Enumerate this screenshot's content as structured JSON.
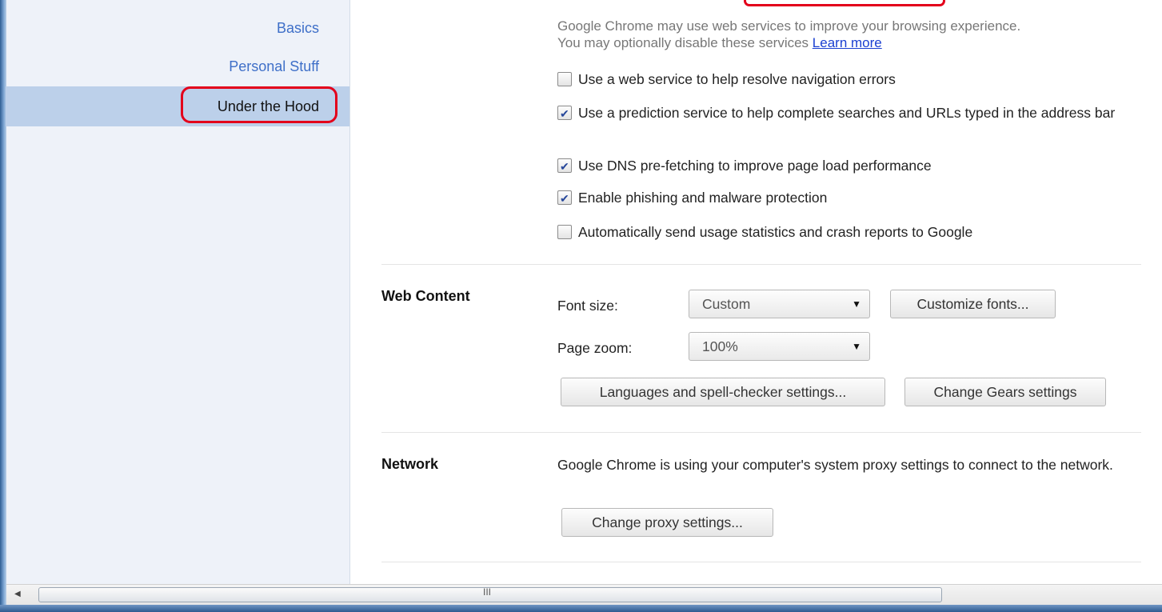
{
  "sidebar": {
    "items": [
      {
        "label": "Basics"
      },
      {
        "label": "Personal Stuff"
      },
      {
        "label": "Under the Hood"
      }
    ]
  },
  "privacy": {
    "description_line1": "Google Chrome may use web services to improve your browsing experience.",
    "description_line2": "You may optionally disable these services",
    "learn_more": "Learn more",
    "options": [
      {
        "label": "Use a web service to help resolve navigation errors",
        "checked": false
      },
      {
        "label": "Use a prediction service to help complete searches and URLs typed in the address bar",
        "checked": true
      },
      {
        "label": "Use DNS pre-fetching to improve page load performance",
        "checked": true
      },
      {
        "label": "Enable phishing and malware protection",
        "checked": true
      },
      {
        "label": "Automatically send usage statistics and crash reports to Google",
        "checked": false
      }
    ]
  },
  "web_content": {
    "title": "Web Content",
    "font_size_label": "Font size:",
    "font_size_value": "Custom",
    "customize_fonts": "Customize fonts...",
    "page_zoom_label": "Page zoom:",
    "page_zoom_value": "100%",
    "languages_button": "Languages and spell-checker settings...",
    "gears_button": "Change Gears settings"
  },
  "network": {
    "title": "Network",
    "description": "Google Chrome is using your computer's system proxy settings to connect to the network.",
    "proxy_button": "Change proxy settings..."
  },
  "scrollbar": {
    "grip": "III"
  },
  "colors": {
    "highlight_ring": "#e3001b",
    "nav_link": "#3e6fc8",
    "nav_selected_bg": "#bcd0ea"
  }
}
